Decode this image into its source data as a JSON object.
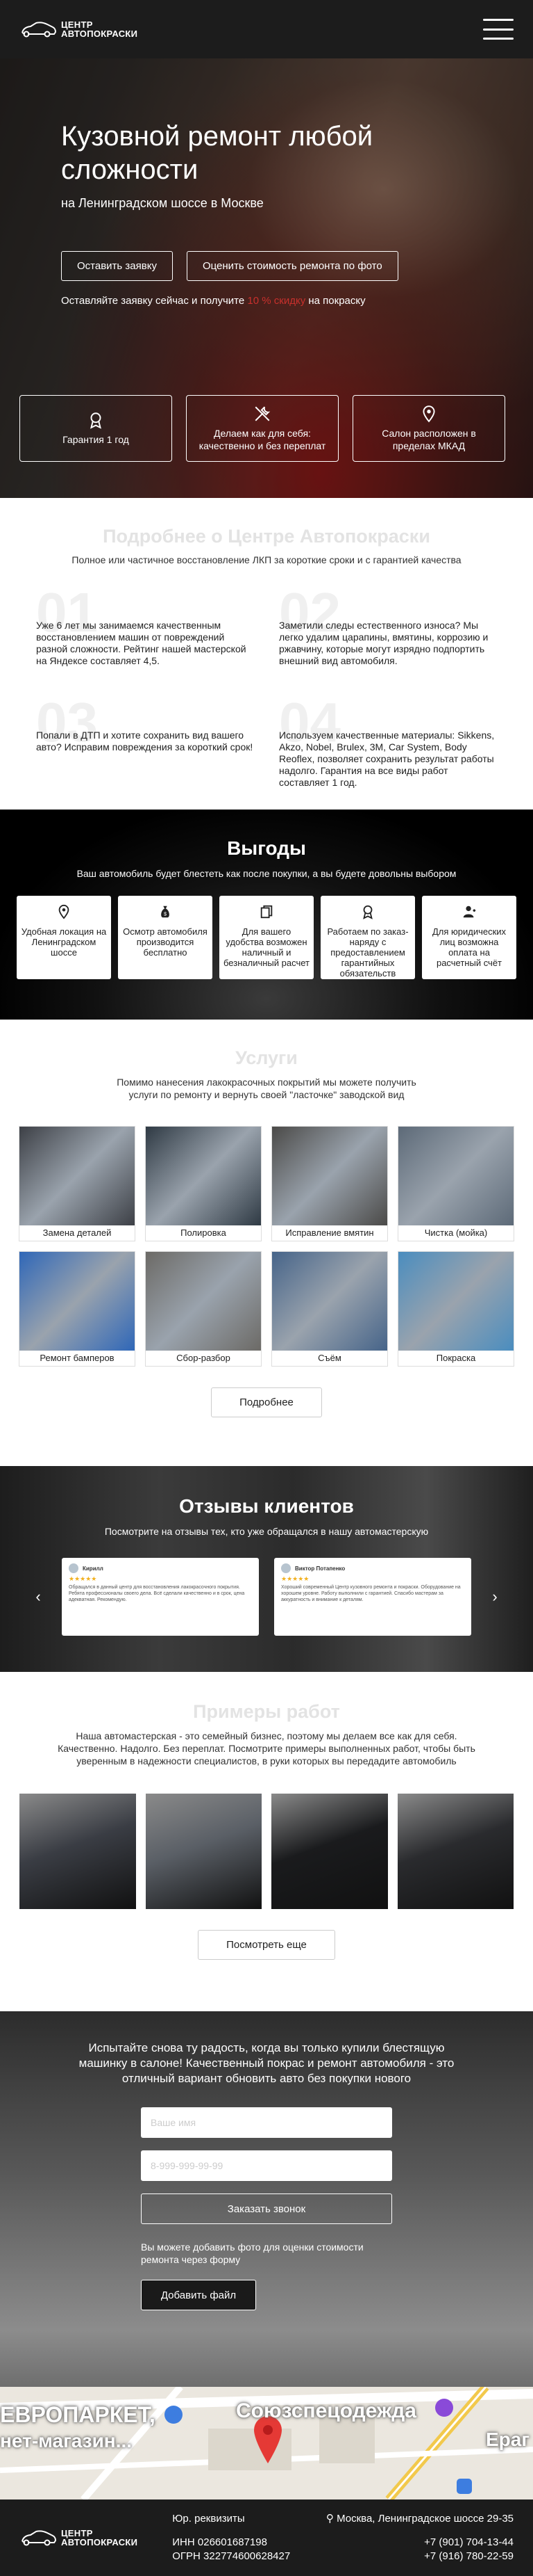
{
  "header": {
    "logo_line1": "ЦЕНТР",
    "logo_line2": "АВТОПОКРАСКИ"
  },
  "hero": {
    "title": "Кузовной ремонт любой сложности",
    "subtitle": "на Ленинградском шоссе в Москве",
    "btn_request": "Оставить заявку",
    "btn_estimate": "Оценить стоимость ремонта по фото",
    "promo_before": "Оставляйте заявку сейчас и получите ",
    "promo_highlight": "10 % скидку",
    "promo_after": " на покраску",
    "cards": [
      {
        "icon": "award-icon",
        "text": "Гарантия 1 год"
      },
      {
        "icon": "tools-icon",
        "text": "Делаем как для себя: качественно и без переплат"
      },
      {
        "icon": "location-icon",
        "text": "Салон расположен в пределах МКАД"
      }
    ]
  },
  "about": {
    "title": "Подробнее о Центре Автопокраски",
    "subtitle": "Полное или частичное восстановление ЛКП за короткие сроки и с гарантией качества",
    "items": [
      {
        "num": "01",
        "text": "Уже 6 лет мы занимаемся качественным восстановлением машин от повреждений разной сложности. Рейтинг нашей мастерской на Яндексе составляет 4,5."
      },
      {
        "num": "02",
        "text": "Заметили следы естественного износа? Мы легко удалим царапины, вмятины, коррозию и ржавчину, которые могут изрядно подпортить внешний вид автомобиля."
      },
      {
        "num": "03",
        "text": "Попали в ДТП и хотите сохранить вид вашего авто? Исправим повреждения за короткий срок!"
      },
      {
        "num": "04",
        "text": "Используем качественные материалы: Sikkens, Akzo, Nobel, Brulex, 3M, Car System, Body Reoflex, позволяет сохранить результат работы надолго. Гарантия на все виды работ составляет 1 год."
      }
    ]
  },
  "benefits": {
    "title": "Выгоды",
    "subtitle": "Ваш автомобиль будет блестеть как после покупки, а вы будете довольны выбором",
    "items": [
      {
        "icon": "location-icon",
        "text": "Удобная локация на Ленинградском шоссе"
      },
      {
        "icon": "money-bag-icon",
        "text": "Осмотр автомобиля производится бесплатно"
      },
      {
        "icon": "copy-icon",
        "text": "Для вашего удобства возможен наличный и безналичный расчет"
      },
      {
        "icon": "award-icon",
        "text": "Работаем по заказ-наряду с предоставлением гарантийных обязательств"
      },
      {
        "icon": "user-icon",
        "text": "Для юридических лиц возможна оплата на расчетный счёт"
      }
    ]
  },
  "services": {
    "title": "Услуги",
    "subtitle": "Помимо нанесения лакокрасочных покрытий мы можете получить услуги по ремонту и вернуть своей \"ласточке\" заводской вид",
    "items": [
      {
        "label": "Замена деталей",
        "color": "#3d4046"
      },
      {
        "label": "Полировка",
        "color": "#2f3a44"
      },
      {
        "label": "Исправление вмятин",
        "color": "#4b4a48"
      },
      {
        "label": "Чистка (мойка)",
        "color": "#5d6a78"
      },
      {
        "label": "Ремонт бамперов",
        "color": "#2f67b8"
      },
      {
        "label": "Сбор-разбор",
        "color": "#6c6a66"
      },
      {
        "label": "Съём",
        "color": "#466489"
      },
      {
        "label": "Покраска",
        "color": "#4a8dbf"
      }
    ],
    "more_button": "Подробнее"
  },
  "reviews": {
    "title": "Отзывы клиентов",
    "subtitle": "Посмотрите на отзывы тех, кто уже обращался в нашу автомастерскую",
    "cards": [
      {
        "name": "Кирилл",
        "stars": "★★★★★",
        "text": "Обращался в данный центр для восстановления лакокрасочного покрытия. Ребята профессионалы своего дела. Всё сделали качественно и в срок, цена адекватная. Рекомендую."
      },
      {
        "name": "Виктор Потапенко",
        "stars": "★★★★★",
        "text": "Хороший современный Центр кузовного ремонта и покраски. Оборудование на хорошем уровне. Работу выполнили с гарантией. Спасибо мастерам за аккуратность и внимание к деталям."
      }
    ],
    "prev": "‹",
    "next": "›"
  },
  "works": {
    "title": "Примеры работ",
    "subtitle": "Наша автомастерская - это семейный бизнес, поэтому мы делаем все как для себя. Качественно. Надолго. Без переплат. Посмотрите примеры выполненных работ, чтобы быть уверенным в надежности специалистов, в руки которых вы передадите автомобиль",
    "items": [
      {
        "color": "#3a3d44"
      },
      {
        "color": "#5a5f66"
      },
      {
        "color": "#1a1b1d"
      },
      {
        "color": "#2a2b2e"
      }
    ],
    "more_button": "Посмотреть еще"
  },
  "contact": {
    "lead": "Испытайте снова ту радость, когда вы только купили блестящую машинку в салоне! Качественный покрас и ремонт автомобиля - это отличный вариант обновить авто без покупки нового",
    "name_placeholder": "Ваше имя",
    "phone_placeholder": "8-999-999-99-99",
    "order_button": "Заказать звонок",
    "note": "Вы можете добавить фото для оценки стоимости ремонта через форму",
    "file_button": "Добавить файл"
  },
  "map": {
    "label1": "ЕВРОПАРКЕТ,",
    "label2": "нет-магазин...",
    "label3": "Союзспецодежда",
    "label4": "Ераг"
  },
  "footer": {
    "legal_title": "Юр. реквизиты",
    "inn": "ИНН 026601687198",
    "ogrn": "ОГРН 322774600628427",
    "address": "Москва, Ленинградское шоссе 29-35",
    "phone1": "+7 (901) 704-13-44",
    "phone2": "+7 (916) 780-22-59"
  }
}
